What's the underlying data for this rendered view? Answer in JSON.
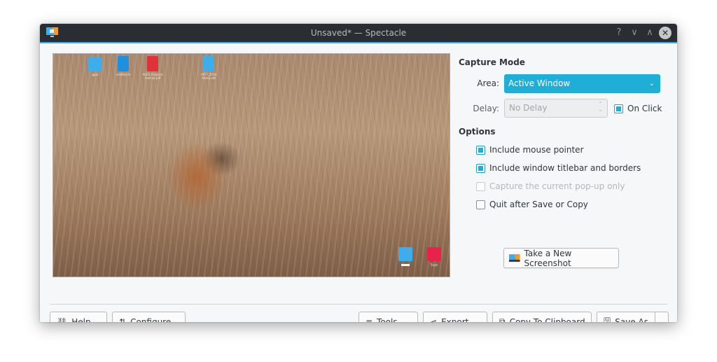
{
  "window": {
    "title": "Unsaved* — Spectacle",
    "titlebar_buttons": [
      {
        "name": "help",
        "icon": "?"
      },
      {
        "name": "minimize",
        "icon": "∨"
      },
      {
        "name": "maximize",
        "icon": "∧"
      },
      {
        "name": "close",
        "icon": "✕"
      }
    ],
    "accent_color": "#3daee9"
  },
  "preview": {
    "description": "Screenshot of desktop with tiger in tall grass wallpaper",
    "desktop_icons": [
      {
        "name": "folder",
        "label": "gpio",
        "color": "#3daee9"
      },
      {
        "name": "c-file",
        "label": "untitled.m",
        "color": "#1e90e0"
      },
      {
        "name": "pdf-file",
        "label": "ASCII_Program mercial.pdf",
        "color": "#e0323a"
      },
      {
        "name": "odt-file",
        "label": "AFFT_2018 Alterp.odt",
        "color": "#3daee9"
      },
      {
        "name": "home-folder",
        "label": "",
        "color": "#3daee9"
      },
      {
        "name": "trash-folder",
        "label": "Trash",
        "color": "#e8224a"
      }
    ]
  },
  "capture_mode": {
    "title": "Capture Mode",
    "area_label": "Area:",
    "area_value": "Active Window",
    "delay_label": "Delay:",
    "delay_value": "No Delay",
    "on_click_label": "On Click",
    "on_click_checked": true
  },
  "options": {
    "title": "Options",
    "items": [
      {
        "label": "Include mouse pointer",
        "checked": true,
        "enabled": true
      },
      {
        "label": "Include window titlebar and borders",
        "checked": true,
        "enabled": true
      },
      {
        "label": "Capture the current pop-up only",
        "checked": false,
        "enabled": false
      },
      {
        "label": "Quit after Save or Copy",
        "checked": false,
        "enabled": true
      }
    ]
  },
  "take_screenshot_label": "Take a New Screenshot",
  "toolbar": {
    "help_label": "Help",
    "configure_label": "Configure...",
    "tools_label": "Tools",
    "export_label": "Export",
    "copy_label": "Copy To Clipboard",
    "save_as_label": "Save As"
  }
}
